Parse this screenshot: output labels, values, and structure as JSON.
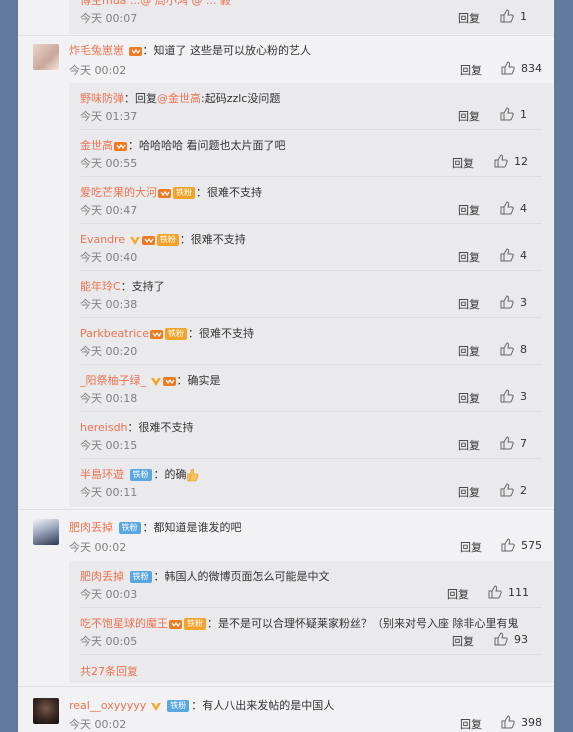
{
  "top_partial": {
    "time": "今天 00:07",
    "reply": "回复",
    "likes": "1",
    "partial_text": "博主mua ...@ 周小鸿 @ ... 毅"
  },
  "comments": [
    {
      "name": "炸毛兔崽崽",
      "text": "：知道了 这些是可以放心粉的艺人",
      "time": "今天 00:02",
      "reply": "回复",
      "likes": "834",
      "replies": [
        {
          "name": "野味防弹",
          "pre": "：回复",
          "at": "@金世高",
          "text": ":起码zzlc没问题",
          "time": "今天 01:37",
          "reply": "回复",
          "likes": "1"
        },
        {
          "name": "金世高",
          "text": "：哈哈哈哈 看问题也太片面了吧",
          "time": "今天 00:55",
          "reply": "回复",
          "likes": "12"
        },
        {
          "name": "爱吃芒果的大河",
          "badge": "铁粉",
          "text": "：很难不支持",
          "time": "今天 00:47",
          "reply": "回复",
          "likes": "4"
        },
        {
          "name": "Evandre",
          "badge": "铁粉",
          "text": "：很难不支持",
          "time": "今天 00:40",
          "reply": "回复",
          "likes": "4"
        },
        {
          "name": "能年玲C",
          "text": "：支持了",
          "time": "今天 00:38",
          "reply": "回复",
          "likes": "3"
        },
        {
          "name": "Parkbeatrice",
          "badge": "铁粉",
          "text": "：很难不支持",
          "time": "今天 00:20",
          "reply": "回复",
          "likes": "8"
        },
        {
          "name": "_阳祭柚子绿_",
          "text": "：确实是",
          "time": "今天 00:18",
          "reply": "回复",
          "likes": "3"
        },
        {
          "name": "hereisdh",
          "text": "：很难不支持",
          "time": "今天 00:15",
          "reply": "回复",
          "likes": "7"
        },
        {
          "name": "半島环遊",
          "badge": "铁粉",
          "text": "：的确",
          "time": "今天 00:11",
          "reply": "回复",
          "likes": "2"
        }
      ]
    },
    {
      "name": "肥肉丢掉",
      "badge": "铁粉",
      "text": "：都知道是谁发的吧",
      "time": "今天 00:02",
      "reply": "回复",
      "likes": "575",
      "replies": [
        {
          "name": "肥肉丢掉",
          "badge": "铁粉",
          "text": "：韩国人的微博页面怎么可能是中文",
          "time": "今天 00:03",
          "reply": "回复",
          "likes": "111"
        },
        {
          "name": "吃不饱星球的魔王",
          "badge": "铁粉",
          "text": "：是不是可以合理怀疑莱家粉丝？（别来对号入座 除非心里有鬼",
          "time": "今天 00:05",
          "reply": "回复",
          "likes": "93"
        }
      ],
      "more": "共27条回复"
    },
    {
      "name": "real__oxyyyyy",
      "badge": "铁粉",
      "text": "：有人八出来发帖的是中国人",
      "time": "今天 00:02",
      "reply": "回复",
      "likes": "398"
    }
  ]
}
